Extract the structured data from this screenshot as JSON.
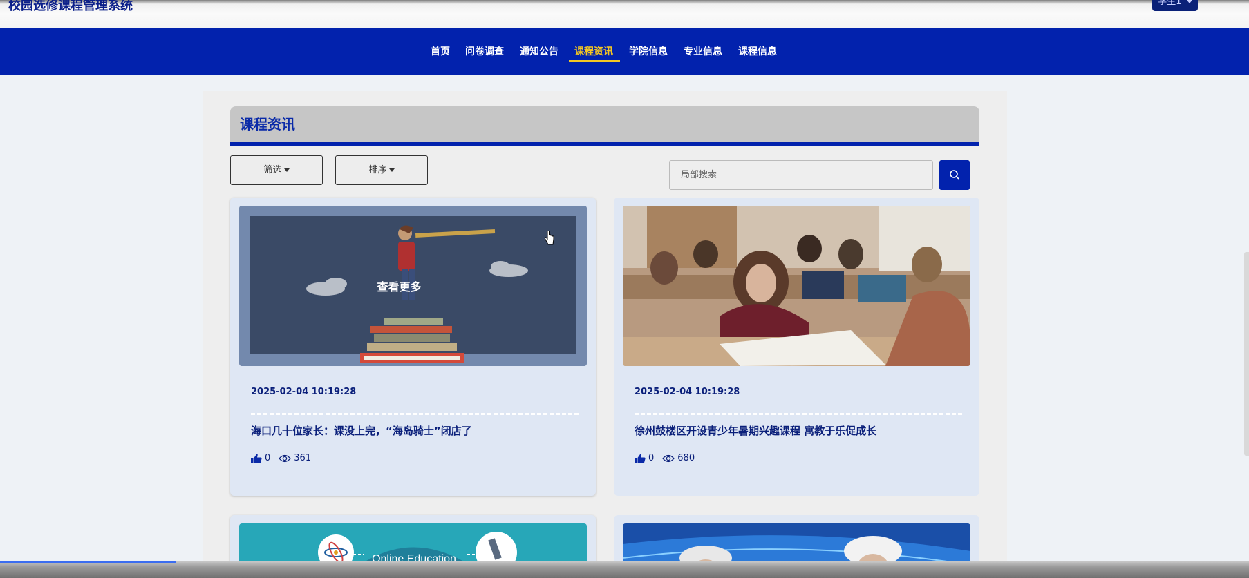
{
  "header": {
    "site_title": "校园选修课程管理系统",
    "user_label": "学生1"
  },
  "nav": {
    "items": [
      {
        "label": "首页"
      },
      {
        "label": "问卷调查"
      },
      {
        "label": "通知公告"
      },
      {
        "label": "课程资讯",
        "active": true
      },
      {
        "label": "学院信息"
      },
      {
        "label": "专业信息"
      },
      {
        "label": "课程信息"
      }
    ],
    "active_color": "#f3c623",
    "bar_color": "#0222ad"
  },
  "section": {
    "title": "课程资讯"
  },
  "toolbar": {
    "filter_label": "筛选",
    "sort_label": "排序",
    "search_placeholder": "局部搜索"
  },
  "cards": [
    {
      "image": "telescope-illustration",
      "overlay_label": "查看更多",
      "date": "2025-02-04 10:19:28",
      "title": "海口几十位家长：课没上完，“海岛骑士”闭店了",
      "likes": "0",
      "views": "361"
    },
    {
      "image": "classroom-photo",
      "date": "2025-02-04 10:19:28",
      "title": "徐州鼓楼区开设青少年暑期兴趣课程 寓教于乐促成长",
      "likes": "0",
      "views": "680"
    },
    {
      "image": "online-education-illustration",
      "image_text": "Online Education"
    },
    {
      "image": "einstein-photo"
    }
  ]
}
